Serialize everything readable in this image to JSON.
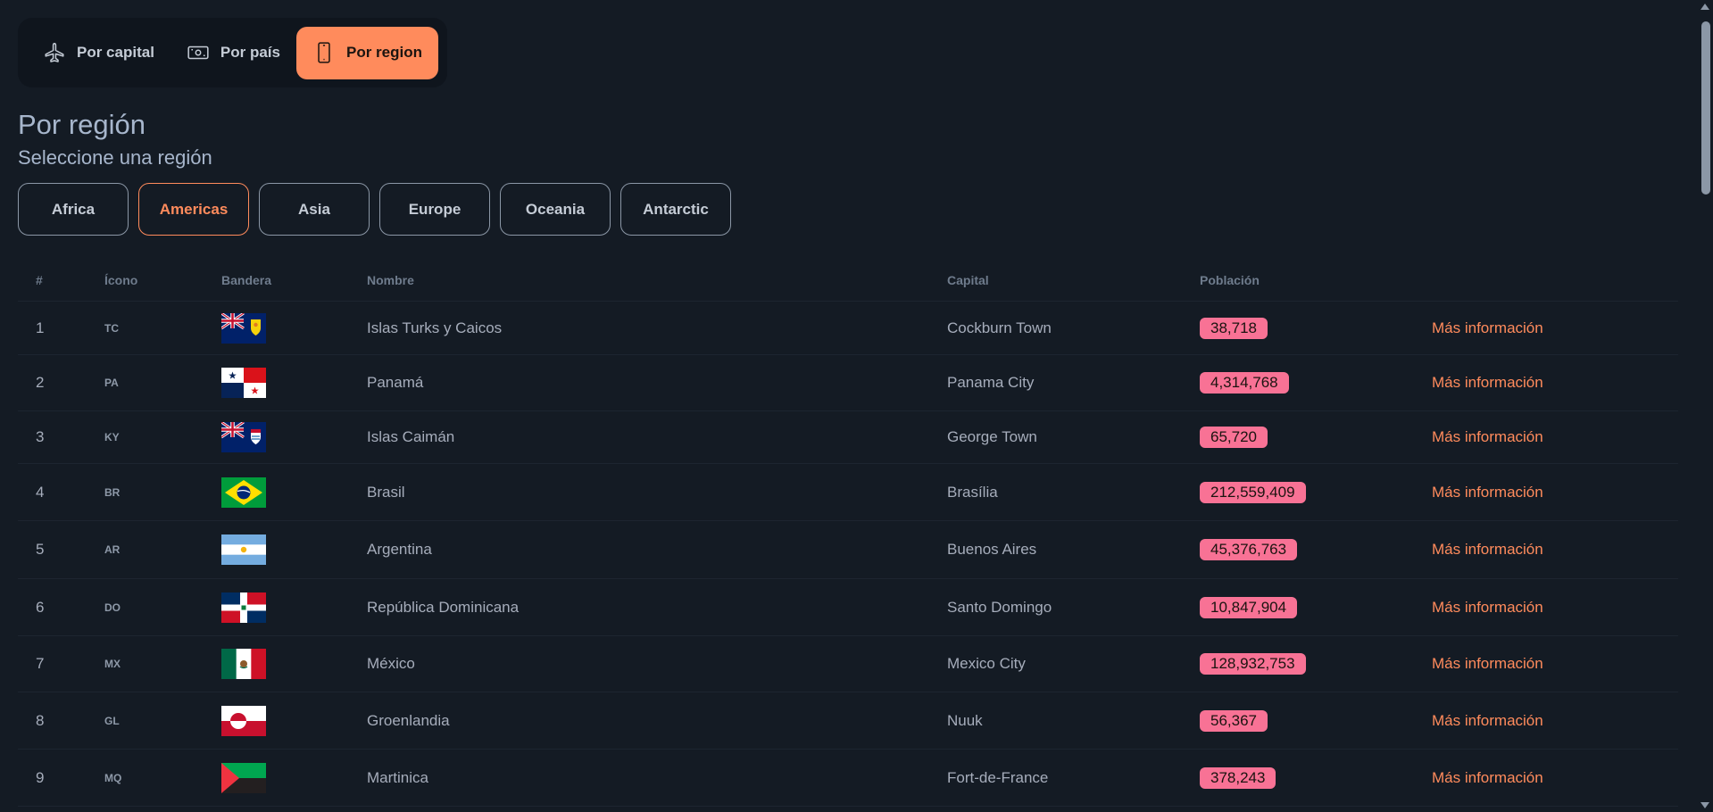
{
  "nav": {
    "items": [
      {
        "label": "Por capital",
        "icon": "airplane-icon"
      },
      {
        "label": "Por país",
        "icon": "banknote-icon"
      },
      {
        "label": "Por region",
        "icon": "smartphone-icon"
      }
    ],
    "active_index": 2,
    "accent": "#ff8b5c"
  },
  "heading": {
    "title": "Por región",
    "subtitle": "Seleccione una región"
  },
  "regions": {
    "items": [
      "Africa",
      "Americas",
      "Asia",
      "Europe",
      "Oceania",
      "Antarctic"
    ],
    "active": "Americas"
  },
  "table": {
    "headers": {
      "num": "#",
      "icon": "Ícono",
      "flag": "Bandera",
      "name": "Nombre",
      "capital": "Capital",
      "population": "Población"
    },
    "more_label": "Más información",
    "badge_color": "#f87295",
    "rows": [
      {
        "num": "1",
        "code": "TC",
        "flag": "flag-tc-icon",
        "name": "Islas Turks y Caicos",
        "capital": "Cockburn Town",
        "population": "38,718"
      },
      {
        "num": "2",
        "code": "PA",
        "flag": "flag-pa-icon",
        "name": "Panamá",
        "capital": "Panama City",
        "population": "4,314,768"
      },
      {
        "num": "3",
        "code": "KY",
        "flag": "flag-ky-icon",
        "name": "Islas Caimán",
        "capital": "George Town",
        "population": "65,720"
      },
      {
        "num": "4",
        "code": "BR",
        "flag": "flag-br-icon",
        "name": "Brasil",
        "capital": "Brasília",
        "population": "212,559,409"
      },
      {
        "num": "5",
        "code": "AR",
        "flag": "flag-ar-icon",
        "name": "Argentina",
        "capital": "Buenos Aires",
        "population": "45,376,763"
      },
      {
        "num": "6",
        "code": "DO",
        "flag": "flag-do-icon",
        "name": "República Dominicana",
        "capital": "Santo Domingo",
        "population": "10,847,904"
      },
      {
        "num": "7",
        "code": "MX",
        "flag": "flag-mx-icon",
        "name": "México",
        "capital": "Mexico City",
        "population": "128,932,753"
      },
      {
        "num": "8",
        "code": "GL",
        "flag": "flag-gl-icon",
        "name": "Groenlandia",
        "capital": "Nuuk",
        "population": "56,367"
      },
      {
        "num": "9",
        "code": "MQ",
        "flag": "flag-mq-icon",
        "name": "Martinica",
        "capital": "Fort-de-France",
        "population": "378,243"
      }
    ]
  }
}
